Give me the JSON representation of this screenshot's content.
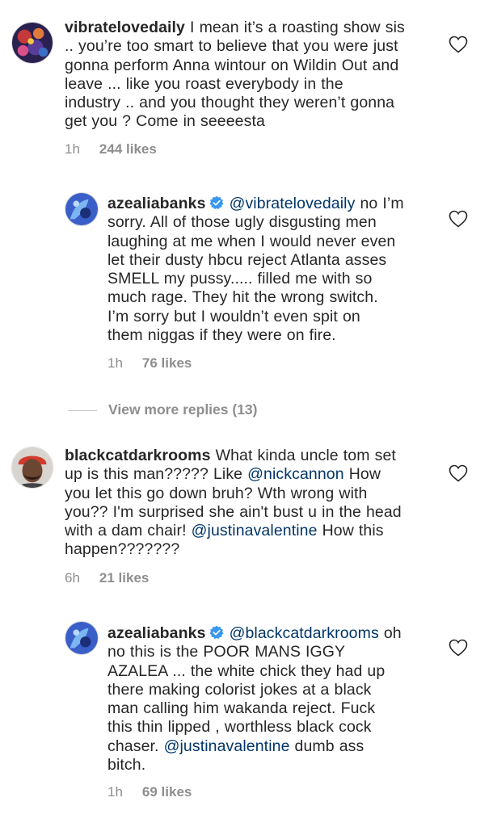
{
  "comments": [
    {
      "username": "vibratelovedaily",
      "lines": [
        " I mean it’s a roasting show sis",
        ".. you’re too smart to believe that you were just",
        "gonna perform Anna wintour on Wildin Out and",
        "leave ... like you roast everybody in the",
        "industry .. and you thought they weren’t gonna",
        "get you ? Come in seeeesta"
      ],
      "time": "1h",
      "likes": "244 likes"
    },
    {
      "username": "azealiabanks",
      "mention": "@vibratelovedaily",
      "lines": [
        " no I’m",
        "sorry. All of those ugly disgusting men",
        "laughing at me when I would never even",
        "let their dusty hbcu reject Atlanta asses",
        "SMELL my pussy..... filled me with so",
        "much rage. They hit the wrong switch.",
        "I’m sorry but I wouldn’t even spit on",
        "them niggas if they were on fire."
      ],
      "time": "1h",
      "likes": "76 likes"
    },
    {
      "username": "blackcatdarkrooms",
      "mention1": "@nickcannon",
      "mention2": "@justinavalentine",
      "lines": [
        " What kinda uncle tom set",
        "up is this man????? Like ",
        " How",
        "you let this go down bruh? Wth wrong with",
        "you?? I'm surprised she ain't bust u in the head",
        "with a dam chair! ",
        " How this",
        "happen???????"
      ],
      "time": "6h",
      "likes": "21 likes"
    },
    {
      "username": "azealiabanks",
      "mention1": "@blackcatdarkrooms",
      "mention2": "@justinavalentine",
      "lines": [
        " oh",
        "no this is the POOR MANS IGGY",
        "AZALEA ... the white chick they had up",
        "there making colorist jokes at a black",
        "man calling him wakanda reject. Fuck",
        "this thin lipped , worthless black cock",
        "chaser. ",
        " dumb ass",
        "bitch."
      ],
      "time": "1h",
      "likes": "69 likes"
    }
  ],
  "view_more": "View more replies (13)",
  "colors": {
    "mention": "#003569",
    "meta": "#8e8e8e",
    "verified": "#3897f0"
  },
  "icons": {
    "like": "heart-outline-icon",
    "verified": "verified-badge-icon"
  }
}
